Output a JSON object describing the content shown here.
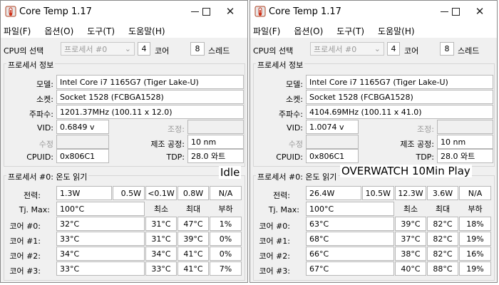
{
  "windows": [
    {
      "title": "Core Temp 1.17",
      "overlay_label": "Idle",
      "menu": [
        "파일(F)",
        "옵션(O)",
        "도구(T)",
        "도움말(H)"
      ],
      "cpu_select_label": "CPU의 선택",
      "processor_combo": "프로세서 #0",
      "cores_value": "4",
      "cores_label": "코어",
      "threads_value": "8",
      "threads_label": "스레드",
      "info_group_title": "프로세서 정보",
      "model_label": "모델:",
      "model_value": "Intel Core i7 1165G7 (Tiger Lake-U)",
      "socket_label": "소켓:",
      "socket_value": "Socket 1528 (FCBGA1528)",
      "freq_label": "주파수:",
      "freq_value": "1201.37MHz (100.11 x 12.0)",
      "vid_label": "VID:",
      "vid_value": "0.6849 v",
      "adjust_label": "조정:",
      "revision_label": "수정",
      "lithography_label": "제조 공정:",
      "lithography_value": "10 nm",
      "cpuid_label": "CPUID:",
      "cpuid_value": "0x806C1",
      "tdp_label": "TDP:",
      "tdp_value": "28.0 와트",
      "temp_group_title": "프로세서 #0: 온도 읽기",
      "power_label": "전력:",
      "power_values": [
        "1.3W",
        "0.5W",
        "<0.1W",
        "0.8W",
        "N/A"
      ],
      "tjmax_label": "Tj. Max:",
      "tjmax_value": "100°C",
      "col_min": "최소",
      "col_max": "최대",
      "col_load": "부하",
      "cores": [
        {
          "label": "코어 #0:",
          "temp": "32°C",
          "min": "31°C",
          "max": "47°C",
          "load": "1%"
        },
        {
          "label": "코어 #1:",
          "temp": "33°C",
          "min": "31°C",
          "max": "39°C",
          "load": "0%"
        },
        {
          "label": "코어 #2:",
          "temp": "34°C",
          "min": "34°C",
          "max": "41°C",
          "load": "0%"
        },
        {
          "label": "코어 #3:",
          "temp": "33°C",
          "min": "33°C",
          "max": "41°C",
          "load": "7%"
        }
      ]
    },
    {
      "title": "Core Temp 1.17",
      "overlay_label": "OVERWATCH 10Min Play",
      "menu": [
        "파일(F)",
        "옵션(O)",
        "도구(T)",
        "도움말(H)"
      ],
      "cpu_select_label": "CPU의 선택",
      "processor_combo": "프로세서 #0",
      "cores_value": "4",
      "cores_label": "코어",
      "threads_value": "8",
      "threads_label": "스레드",
      "info_group_title": "프로세서 정보",
      "model_label": "모델:",
      "model_value": "Intel Core i7 1165G7 (Tiger Lake-U)",
      "socket_label": "소켓:",
      "socket_value": "Socket 1528 (FCBGA1528)",
      "freq_label": "주파수:",
      "freq_value": "4104.69MHz (100.11 x 41.0)",
      "vid_label": "VID:",
      "vid_value": "1.0074 v",
      "adjust_label": "조정:",
      "revision_label": "수정",
      "lithography_label": "제조 공정:",
      "lithography_value": "10 nm",
      "cpuid_label": "CPUID:",
      "cpuid_value": "0x806C1",
      "tdp_label": "TDP:",
      "tdp_value": "28.0 와트",
      "temp_group_title": "프로세서 #0: 온도 읽기",
      "power_label": "전력:",
      "power_values": [
        "26.4W",
        "10.5W",
        "12.3W",
        "3.6W",
        "N/A"
      ],
      "tjmax_label": "Tj. Max:",
      "tjmax_value": "100°C",
      "col_min": "최소",
      "col_max": "최대",
      "col_load": "부하",
      "cores": [
        {
          "label": "코어 #0:",
          "temp": "63°C",
          "min": "39°C",
          "max": "82°C",
          "load": "18%"
        },
        {
          "label": "코어 #1:",
          "temp": "68°C",
          "min": "37°C",
          "max": "82°C",
          "load": "19%"
        },
        {
          "label": "코어 #2:",
          "temp": "66°C",
          "min": "38°C",
          "max": "82°C",
          "load": "16%"
        },
        {
          "label": "코어 #3:",
          "temp": "67°C",
          "min": "40°C",
          "max": "88°C",
          "load": "19%"
        }
      ]
    }
  ]
}
